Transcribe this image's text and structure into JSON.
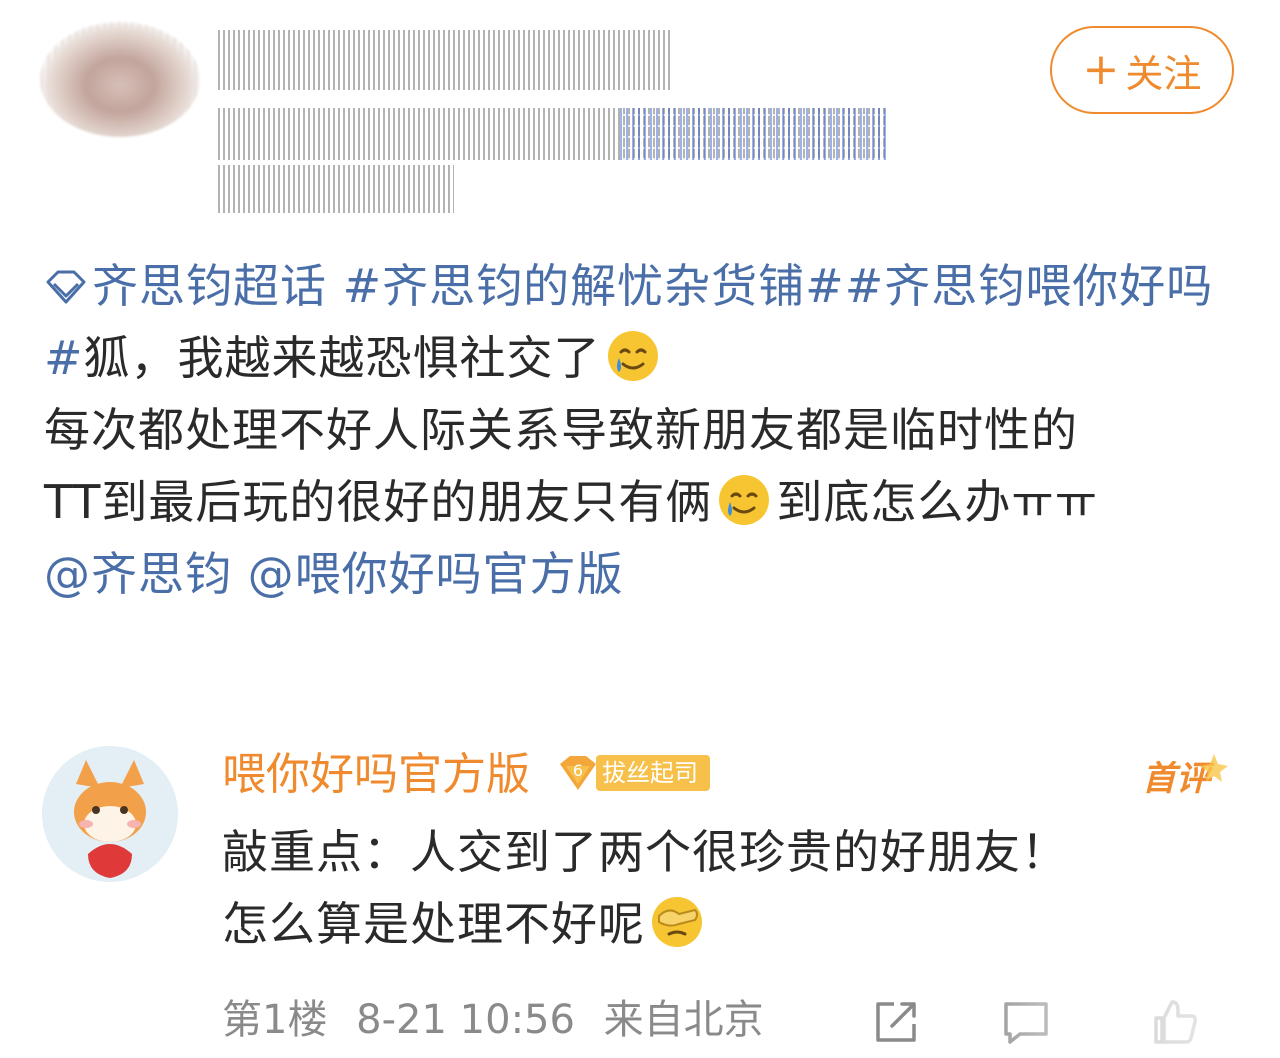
{
  "header": {
    "follow_button": {
      "plus": "+",
      "label": "关注"
    }
  },
  "post": {
    "line1": {
      "super_topic": "齐思钧超话",
      "topic_a": "#齐思钧的解忧杂货铺#",
      "topic_b": "#齐思钧喂你好吗#",
      "text": "狐，我越来越恐惧社交了"
    },
    "line2": "每次都处理不好人际关系导致新朋友都是临时性的",
    "line3": {
      "text_before": "TT到最后玩的很好的朋友只有俩",
      "text_after": "到底怎么办ㅠㅠ"
    },
    "mentions": [
      "@齐思钧",
      "@喂你好吗官方版"
    ]
  },
  "comment": {
    "author": "喂你好吗官方版",
    "badge": {
      "level": "6",
      "text": "拔丝起司"
    },
    "first_floor_label": "首评",
    "text_line1": "敲重点：人交到了两个很珍贵的好朋友！",
    "text_line2": "怎么算是处理不好呢",
    "meta": {
      "floor": "第1楼",
      "time": "8-21 10:56",
      "location": "来自北京"
    }
  },
  "icons": {
    "topic": "super-topic-diamond-icon",
    "cry_smile": "smiling-with-tear-emoji",
    "facepalm": "facepalm-emoji",
    "share": "share-icon",
    "comment": "comment-icon",
    "like": "like-icon"
  },
  "colors": {
    "accent_orange": "#f08a2e",
    "link_blue": "#4a6ea8",
    "meta_gray": "#8a8a8a"
  }
}
